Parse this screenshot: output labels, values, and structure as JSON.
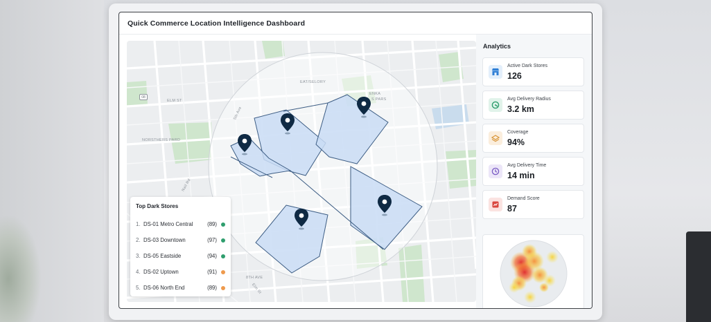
{
  "app": {
    "title": "Quick Commerce Location Intelligence Dashboard"
  },
  "map": {
    "street_labels": [
      "EAT/SELORY",
      "ENKA",
      "S PARS",
      "ELM ST",
      "NORSTHERS PARD",
      "5th Ave",
      "Nail Rd",
      "8th AVE",
      "Elm St"
    ],
    "road_badge": "08",
    "colors": {
      "zone_fill": "#c9dcf5",
      "zone_stroke": "#3d5d84",
      "marker": "#0f2a44",
      "park": "#cfe6cd",
      "water": "#c9dced"
    }
  },
  "top_stores": {
    "title": "Top Dark Stores",
    "items": [
      {
        "rank": "1.",
        "name": "DS-01 Metro Central",
        "score": "(89)",
        "status_color": "#2f9e6e"
      },
      {
        "rank": "2.",
        "name": "DS-03 Downtown",
        "score": "(97)",
        "status_color": "#2f9e6e"
      },
      {
        "rank": "3.",
        "name": "DS-05 Eastside",
        "score": "(94)",
        "status_color": "#2f9e6e"
      },
      {
        "rank": "4.",
        "name": "DS-02 Uptown",
        "score": "(91)",
        "status_color": "#ee9a4d"
      },
      {
        "rank": "5.",
        "name": "DS-06 North End",
        "score": "(89)",
        "status_color": "#ee9a4d"
      }
    ]
  },
  "analytics": {
    "title": "Analytics",
    "cards": [
      {
        "label": "Active Dark Stores",
        "value": "126",
        "icon": "store-icon",
        "color": "#2f7fd6",
        "bg": "#e3effb"
      },
      {
        "label": "Avg Delivery Radius",
        "value": "3.2 km",
        "icon": "radius-icon",
        "color": "#2f9e6e",
        "bg": "#e1f3ea"
      },
      {
        "label": "Coverage",
        "value": "94%",
        "icon": "coverage-icon",
        "color": "#d9963a",
        "bg": "#fbeedd"
      },
      {
        "label": "Avg Delivery Time",
        "value": "14 min",
        "icon": "clock-icon",
        "color": "#7b5cc4",
        "bg": "#ece6f8"
      },
      {
        "label": "Demand Score",
        "value": "87",
        "icon": "demand-icon",
        "color": "#d9473f",
        "bg": "#fbe3e1"
      }
    ]
  }
}
